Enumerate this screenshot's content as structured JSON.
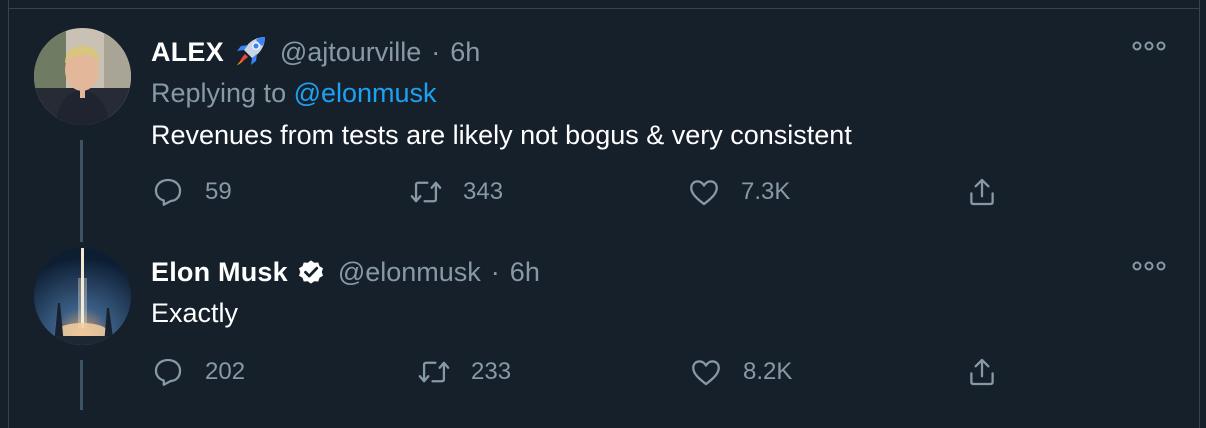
{
  "tweets": [
    {
      "author_name": "ALEX",
      "author_emoji": "rocket",
      "author_handle": "@ajtourville",
      "separator": "·",
      "time": "6h",
      "replying_prefix": "Replying to ",
      "replying_mention": "@elonmusk",
      "text": "Revenues from tests are likely not bogus & very consistent",
      "replies": "59",
      "retweets": "343",
      "likes": "7.3K"
    },
    {
      "author_name": "Elon Musk",
      "verified": true,
      "author_handle": "@elonmusk",
      "separator": "·",
      "time": "6h",
      "text": "Exactly",
      "replies": "202",
      "retweets": "233",
      "likes": "8.2K"
    }
  ],
  "icons": {
    "reply": "reply-icon",
    "retweet": "retweet-icon",
    "like": "heart-icon",
    "share": "share-icon",
    "more": "more-icon"
  },
  "colors": {
    "background": "#15202b",
    "muted": "#8899a6",
    "link": "#1da1f2",
    "border": "#38444d"
  }
}
